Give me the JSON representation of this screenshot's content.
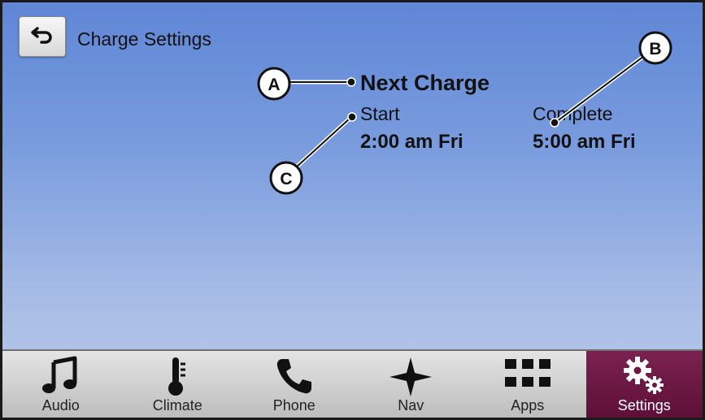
{
  "header": {
    "back_icon": "back-arrow-icon",
    "title": "Charge Settings"
  },
  "charge": {
    "heading": "Next Charge",
    "start_label": "Start",
    "start_time": "2:00 am Fri",
    "complete_label": "Complete",
    "complete_time": "5:00 am Fri"
  },
  "callouts": {
    "a": "A",
    "b": "B",
    "c": "C"
  },
  "navbar": {
    "items": [
      {
        "label": "Audio",
        "icon": "music-note-icon"
      },
      {
        "label": "Climate",
        "icon": "thermometer-icon"
      },
      {
        "label": "Phone",
        "icon": "phone-icon"
      },
      {
        "label": "Nav",
        "icon": "compass-star-icon"
      },
      {
        "label": "Apps",
        "icon": "grid-icon"
      },
      {
        "label": "Settings",
        "icon": "gears-icon"
      }
    ],
    "active_color": "#6b1743"
  }
}
